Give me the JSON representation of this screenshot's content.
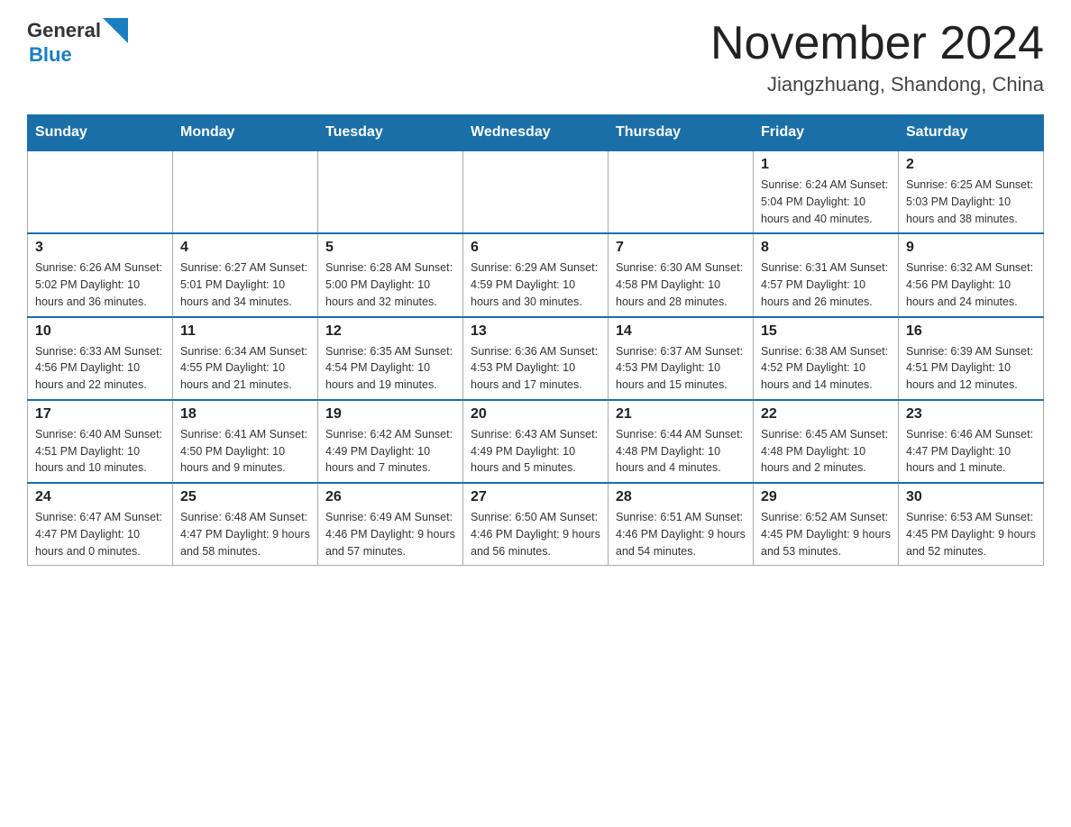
{
  "header": {
    "logo_general": "General",
    "logo_blue": "Blue",
    "title": "November 2024",
    "subtitle": "Jiangzhuang, Shandong, China"
  },
  "days_of_week": [
    "Sunday",
    "Monday",
    "Tuesday",
    "Wednesday",
    "Thursday",
    "Friday",
    "Saturday"
  ],
  "weeks": [
    [
      {
        "day": "",
        "info": ""
      },
      {
        "day": "",
        "info": ""
      },
      {
        "day": "",
        "info": ""
      },
      {
        "day": "",
        "info": ""
      },
      {
        "day": "",
        "info": ""
      },
      {
        "day": "1",
        "info": "Sunrise: 6:24 AM\nSunset: 5:04 PM\nDaylight: 10 hours and 40 minutes."
      },
      {
        "day": "2",
        "info": "Sunrise: 6:25 AM\nSunset: 5:03 PM\nDaylight: 10 hours and 38 minutes."
      }
    ],
    [
      {
        "day": "3",
        "info": "Sunrise: 6:26 AM\nSunset: 5:02 PM\nDaylight: 10 hours and 36 minutes."
      },
      {
        "day": "4",
        "info": "Sunrise: 6:27 AM\nSunset: 5:01 PM\nDaylight: 10 hours and 34 minutes."
      },
      {
        "day": "5",
        "info": "Sunrise: 6:28 AM\nSunset: 5:00 PM\nDaylight: 10 hours and 32 minutes."
      },
      {
        "day": "6",
        "info": "Sunrise: 6:29 AM\nSunset: 4:59 PM\nDaylight: 10 hours and 30 minutes."
      },
      {
        "day": "7",
        "info": "Sunrise: 6:30 AM\nSunset: 4:58 PM\nDaylight: 10 hours and 28 minutes."
      },
      {
        "day": "8",
        "info": "Sunrise: 6:31 AM\nSunset: 4:57 PM\nDaylight: 10 hours and 26 minutes."
      },
      {
        "day": "9",
        "info": "Sunrise: 6:32 AM\nSunset: 4:56 PM\nDaylight: 10 hours and 24 minutes."
      }
    ],
    [
      {
        "day": "10",
        "info": "Sunrise: 6:33 AM\nSunset: 4:56 PM\nDaylight: 10 hours and 22 minutes."
      },
      {
        "day": "11",
        "info": "Sunrise: 6:34 AM\nSunset: 4:55 PM\nDaylight: 10 hours and 21 minutes."
      },
      {
        "day": "12",
        "info": "Sunrise: 6:35 AM\nSunset: 4:54 PM\nDaylight: 10 hours and 19 minutes."
      },
      {
        "day": "13",
        "info": "Sunrise: 6:36 AM\nSunset: 4:53 PM\nDaylight: 10 hours and 17 minutes."
      },
      {
        "day": "14",
        "info": "Sunrise: 6:37 AM\nSunset: 4:53 PM\nDaylight: 10 hours and 15 minutes."
      },
      {
        "day": "15",
        "info": "Sunrise: 6:38 AM\nSunset: 4:52 PM\nDaylight: 10 hours and 14 minutes."
      },
      {
        "day": "16",
        "info": "Sunrise: 6:39 AM\nSunset: 4:51 PM\nDaylight: 10 hours and 12 minutes."
      }
    ],
    [
      {
        "day": "17",
        "info": "Sunrise: 6:40 AM\nSunset: 4:51 PM\nDaylight: 10 hours and 10 minutes."
      },
      {
        "day": "18",
        "info": "Sunrise: 6:41 AM\nSunset: 4:50 PM\nDaylight: 10 hours and 9 minutes."
      },
      {
        "day": "19",
        "info": "Sunrise: 6:42 AM\nSunset: 4:49 PM\nDaylight: 10 hours and 7 minutes."
      },
      {
        "day": "20",
        "info": "Sunrise: 6:43 AM\nSunset: 4:49 PM\nDaylight: 10 hours and 5 minutes."
      },
      {
        "day": "21",
        "info": "Sunrise: 6:44 AM\nSunset: 4:48 PM\nDaylight: 10 hours and 4 minutes."
      },
      {
        "day": "22",
        "info": "Sunrise: 6:45 AM\nSunset: 4:48 PM\nDaylight: 10 hours and 2 minutes."
      },
      {
        "day": "23",
        "info": "Sunrise: 6:46 AM\nSunset: 4:47 PM\nDaylight: 10 hours and 1 minute."
      }
    ],
    [
      {
        "day": "24",
        "info": "Sunrise: 6:47 AM\nSunset: 4:47 PM\nDaylight: 10 hours and 0 minutes."
      },
      {
        "day": "25",
        "info": "Sunrise: 6:48 AM\nSunset: 4:47 PM\nDaylight: 9 hours and 58 minutes."
      },
      {
        "day": "26",
        "info": "Sunrise: 6:49 AM\nSunset: 4:46 PM\nDaylight: 9 hours and 57 minutes."
      },
      {
        "day": "27",
        "info": "Sunrise: 6:50 AM\nSunset: 4:46 PM\nDaylight: 9 hours and 56 minutes."
      },
      {
        "day": "28",
        "info": "Sunrise: 6:51 AM\nSunset: 4:46 PM\nDaylight: 9 hours and 54 minutes."
      },
      {
        "day": "29",
        "info": "Sunrise: 6:52 AM\nSunset: 4:45 PM\nDaylight: 9 hours and 53 minutes."
      },
      {
        "day": "30",
        "info": "Sunrise: 6:53 AM\nSunset: 4:45 PM\nDaylight: 9 hours and 52 minutes."
      }
    ]
  ]
}
